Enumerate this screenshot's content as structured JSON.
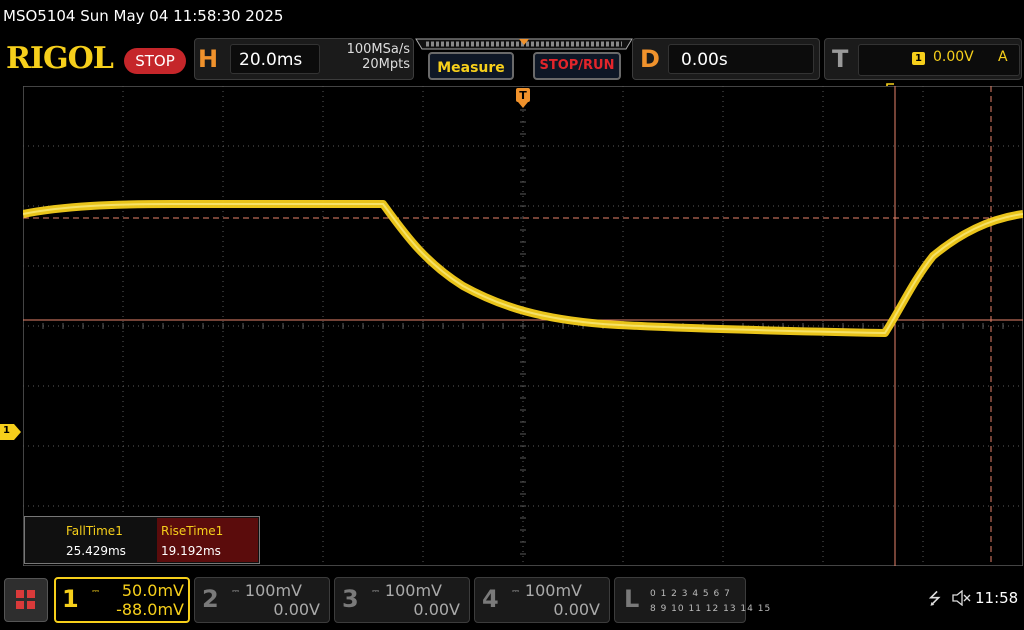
{
  "title_bar": {
    "text": "MSO5104  Sun May 04 11:58:30 2025"
  },
  "toolbar": {
    "logo": "RIGOL",
    "run_state": "STOP",
    "horizontal": {
      "letter": "H",
      "scale": "20.0ms",
      "sample_rate": "100MSa/s",
      "memory_depth": "20Mpts"
    },
    "measure_label": "Measure",
    "stop_run_label": "STOP/RUN",
    "delay": {
      "letter": "D",
      "value": "0.00s"
    },
    "trigger": {
      "letter": "T",
      "source": "1",
      "level": "0.00V",
      "mode": "A",
      "edge_icon": "rising-edge-icon"
    }
  },
  "measurements": [
    {
      "name": "FallTime1",
      "value": "25.429ms"
    },
    {
      "name": "RiseTime1",
      "value": "19.192ms"
    }
  ],
  "channel_marker": "1",
  "channels": [
    {
      "num": "1",
      "scale": "50.0mV",
      "offset": "-88.0mV",
      "active": true,
      "color": "#f6cf1b"
    },
    {
      "num": "2",
      "scale": "100mV",
      "offset": "0.00V",
      "active": false,
      "color": "#7a7a7a"
    },
    {
      "num": "3",
      "scale": "100mV",
      "offset": "0.00V",
      "active": false,
      "color": "#7a7a7a"
    },
    {
      "num": "4",
      "scale": "100mV",
      "offset": "0.00V",
      "active": false,
      "color": "#7a7a7a"
    }
  ],
  "logic": {
    "letter": "L",
    "row1": "0 1 2 3  4 5 6 7",
    "row2": "8 9 10 11 12 13 14 15"
  },
  "status": {
    "clock": "11:58"
  },
  "colors": {
    "trace": "#f6cf1b",
    "cursor": "#e8836b",
    "grid": "#5a5a5a",
    "accent": "#f0922c"
  }
}
